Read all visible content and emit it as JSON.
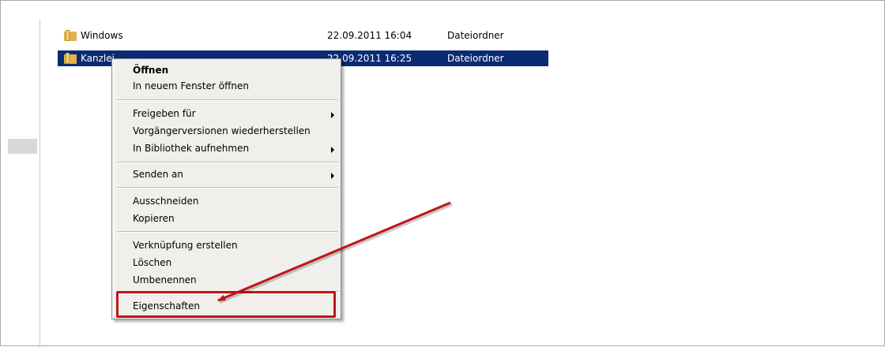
{
  "files": [
    {
      "name": "Windows",
      "date": "22.09.2011 16:04",
      "type": "Dateiordner",
      "icon": "folder-icon"
    },
    {
      "name": "Kanzlei",
      "date": "22.09.2011 16:25",
      "type": "Dateiordner",
      "icon": "folder-icon",
      "selected": true
    }
  ],
  "context_menu": {
    "items": [
      {
        "label": "Öffnen",
        "bold": true
      },
      {
        "label": "In neuem Fenster öffnen"
      },
      {
        "label": "Freigeben für",
        "submenu": true
      },
      {
        "label": "Vorgängerversionen wiederherstellen"
      },
      {
        "label": "In Bibliothek aufnehmen",
        "submenu": true
      },
      {
        "label": "Senden an",
        "submenu": true
      },
      {
        "label": "Ausschneiden"
      },
      {
        "label": "Kopieren"
      },
      {
        "label": "Verknüpfung erstellen"
      },
      {
        "label": "Löschen"
      },
      {
        "label": "Umbenennen"
      },
      {
        "label": "Eigenschaften",
        "highlighted": true
      }
    ]
  },
  "colors": {
    "selection": "#0b2a74",
    "menu_background": "#f1efec",
    "annotation": "#c0141b"
  }
}
